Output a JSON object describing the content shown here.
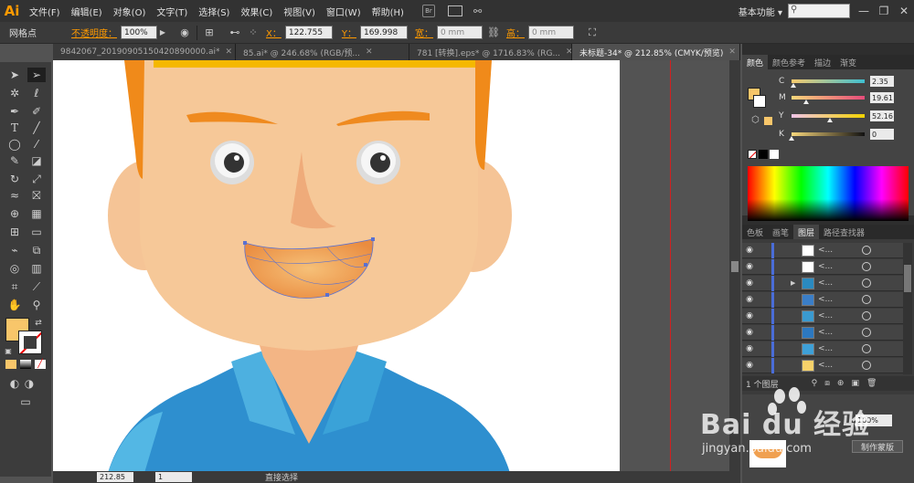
{
  "menubar": {
    "logo": "Ai",
    "items": [
      "文件(F)",
      "编辑(E)",
      "对象(O)",
      "文字(T)",
      "选择(S)",
      "效果(C)",
      "视图(V)",
      "窗口(W)",
      "帮助(H)"
    ],
    "workspace": "基本功能",
    "window_buttons": [
      "—",
      "❐",
      "✕"
    ]
  },
  "controlbar": {
    "selection_label": "网格点",
    "opacity_label": "不透明度：",
    "opacity_value": "100%",
    "x_label": "X：",
    "x_value": "122.755",
    "y_label": "Y：",
    "y_value": "169.998",
    "w_label": "宽：",
    "w_value": "0 mm",
    "h_label": "高：",
    "h_value": "0 mm"
  },
  "tabs": [
    {
      "label": "9842067_20190905150420890000.ai*",
      "active": false
    },
    {
      "label": "85.ai* @ 246.68% (RGB/预...",
      "active": false
    },
    {
      "label": "781 [转换].eps* @ 1716.83% (RG...",
      "active": false
    },
    {
      "label": "未标题-34* @ 212.85% (CMYK/预览)",
      "active": true
    }
  ],
  "statusbar": {
    "zoom": "212.85",
    "page": "1",
    "tool_name": "直接选择"
  },
  "color_panel": {
    "tabs": [
      "颜色",
      "颜色参考",
      "描边",
      "渐变"
    ],
    "fill_color": "#f8c66a",
    "channels": [
      {
        "label": "C",
        "value": "2.35",
        "fraction": 0.0235,
        "gradient": "linear-gradient(to right,#f7ca6d,#3fbfd0)"
      },
      {
        "label": "M",
        "value": "19.61",
        "fraction": 0.1961,
        "gradient": "linear-gradient(to right,#f9d77a,#e64b7a)"
      },
      {
        "label": "Y",
        "value": "52.16",
        "fraction": 0.5216,
        "gradient": "linear-gradient(to right,#f0c4e8,#f2d300)"
      },
      {
        "label": "K",
        "value": "0",
        "fraction": 0.0,
        "gradient": "linear-gradient(to right,#f8d77c,#111111)"
      }
    ]
  },
  "layers_panel": {
    "tabs": [
      "色板",
      "画笔",
      "图层",
      "路径查找器"
    ],
    "rows": [
      {
        "label": "<...",
        "thumb": "#ffffff",
        "expand": false
      },
      {
        "label": "<...",
        "thumb": "#ffffff",
        "expand": false
      },
      {
        "label": "<...",
        "thumb": "#2a8ac0",
        "expand": true
      },
      {
        "label": "<...",
        "thumb": "#3a7ec8",
        "expand": false
      },
      {
        "label": "<...",
        "thumb": "#3a9ad0",
        "expand": false
      },
      {
        "label": "<...",
        "thumb": "#2c78c0",
        "expand": false
      },
      {
        "label": "<...",
        "thumb": "#3ea0d8",
        "expand": false
      },
      {
        "label": "<...",
        "thumb": "#f7d26a",
        "expand": false
      }
    ],
    "footer_label": "1 个图层"
  },
  "transparency_panel": {
    "opacity_value": "100%",
    "mask_button": "制作蒙版"
  },
  "watermark": {
    "brand": "Bai du 经验",
    "url": "jingyan.baidu.com"
  }
}
